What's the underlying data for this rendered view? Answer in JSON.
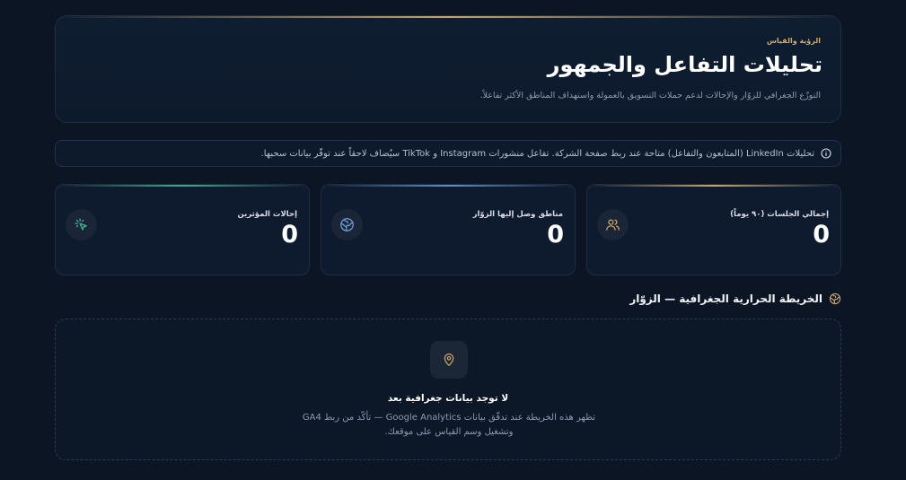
{
  "hero": {
    "eyebrow": "الرؤية والقياس",
    "title": "تحليلات التفاعل والجمهور",
    "subtitle": "التوزّع الجغرافي للزوّار والإحالات لدعم حملات التسويق بالعمولة واستهداف المناطق الأكثر تفاعلاً."
  },
  "notice": {
    "icon": "info-icon",
    "text": "تحليلات LinkedIn (المتابعون والتفاعل) متاحة عند ربط صفحة الشركة. تفاعل منشورات Instagram و TikTok سيُضاف لاحقاً عند توفّر بيانات سحبها."
  },
  "stats": [
    {
      "label": "إجمالي الجلسات (٩٠ يوماً)",
      "value": "0",
      "icon": "users-icon",
      "accent": "#c9a36a"
    },
    {
      "label": "مناطق وصل إليها الزوّار",
      "value": "0",
      "icon": "globe-icon",
      "accent": "#5b8fc9"
    },
    {
      "label": "إحالات المؤثرين",
      "value": "0",
      "icon": "cursor-click-icon",
      "accent": "#3fa88e"
    }
  ],
  "section": {
    "title": "الخريطة الحرارية الجغرافية — الزوّار",
    "icon": "globe-icon"
  },
  "empty": {
    "icon": "map-pin-icon",
    "title": "لا توجد بيانات جغرافية بعد",
    "description": "تظهر هذه الخريطة عند تدفّق بيانات Google Analytics — تأكّد من ربط GA4 وتشغيل وسم القياس على موقعك."
  },
  "colors": {
    "background": "#0b1524",
    "gold": "#c9a36a",
    "teal": "#3fa88e",
    "blue": "#5b8fc9"
  }
}
